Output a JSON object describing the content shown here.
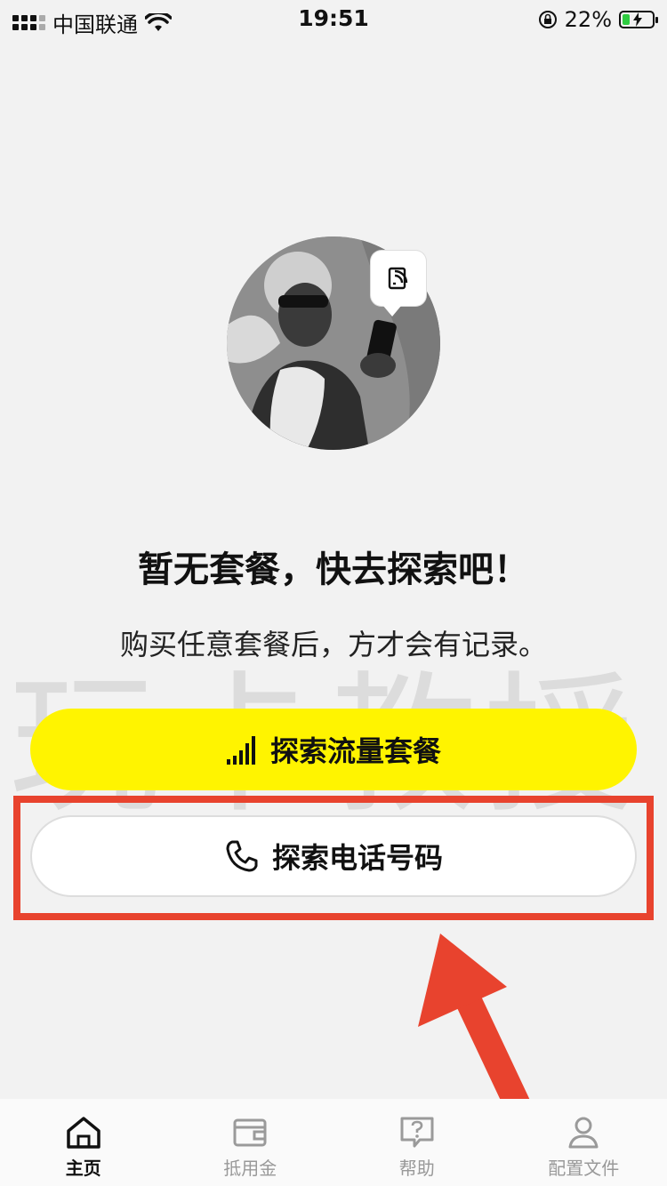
{
  "status_bar": {
    "carrier": "中国联通",
    "time": "19:51",
    "battery": "22%"
  },
  "empty_state": {
    "title": "暂无套餐，快去探索吧！",
    "description": "购买任意套餐后，方才会有记录。"
  },
  "buttons": {
    "explore_data": "探索流量套餐",
    "explore_phone": "探索电话号码"
  },
  "watermark": "玩卡教授",
  "tabs": [
    {
      "label": "主页",
      "icon": "home-icon",
      "active": true
    },
    {
      "label": "抵用金",
      "icon": "wallet-icon",
      "active": false
    },
    {
      "label": "帮助",
      "icon": "help-icon",
      "active": false
    },
    {
      "label": "配置文件",
      "icon": "profile-icon",
      "active": false
    }
  ],
  "colors": {
    "accent": "#fff400",
    "annotation": "#e8432e",
    "background": "#f2f2f2"
  }
}
